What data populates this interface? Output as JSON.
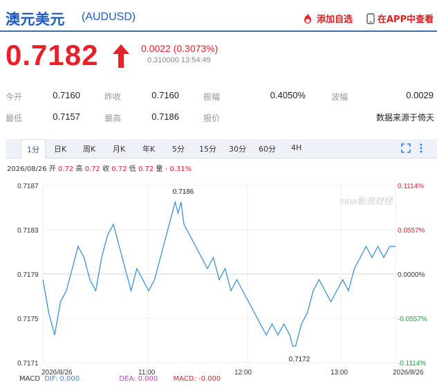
{
  "header": {
    "title_cn": "澳元美元",
    "title_code": "(AUDUSD)",
    "add_watch_label": "添加自选",
    "app_view_label": "在APP中查看",
    "icons": {
      "add_watch": "flame-icon",
      "app_view": "phone-icon"
    }
  },
  "quote": {
    "price": "0.7182",
    "change": "0.0022 (0.3073%)",
    "sub_info": "0.310000 13:54:49",
    "direction": "up",
    "up_color": "#e8202a"
  },
  "stats": [
    [
      {
        "label": "今开",
        "value": "0.7160"
      },
      {
        "label": "昨收",
        "value": "0.7160"
      },
      {
        "label": "振幅",
        "value": "0.4050%"
      },
      {
        "label": "波幅",
        "value": "0.0029"
      }
    ],
    [
      {
        "label": "最低",
        "value": "0.7157"
      },
      {
        "label": "最高",
        "value": "0.7186"
      },
      {
        "label": "报价",
        "value": ""
      },
      {
        "label": "",
        "value": "数据来源于倚天"
      }
    ]
  ],
  "tabs": [
    "1分",
    "日K",
    "周K",
    "月K",
    "年K",
    "5分",
    "15分",
    "30分",
    "60分",
    "4H"
  ],
  "active_tab": "1分",
  "toolbar_icons": [
    "fullscreen-icon",
    "more-icon"
  ],
  "ohlc": {
    "date": "2026/08/26",
    "open_label": "开",
    "open": "0.72",
    "high_label": "高",
    "high": "0.72",
    "close_label": "收",
    "close": "0.72",
    "low_label": "低",
    "low": "0.72",
    "vol_label": "量",
    "vol_value": "- 0.31%"
  },
  "chart_data": {
    "type": "line",
    "yticks_left": [
      "0.7187",
      "0.7183",
      "0.7179",
      "0.7175",
      "0.7171"
    ],
    "yticks_right": [
      "0.1114%",
      "0.0557%",
      "0.0000%",
      "-0.0557%",
      "-0.1114%"
    ],
    "xticks": [
      "2026/8/26",
      "11:00",
      "12:00",
      "13:00",
      "2026/8/26"
    ],
    "ylim": [
      0.7171,
      0.7187
    ],
    "annotations": [
      {
        "text": "0.7186",
        "x": 94,
        "y": 0.7186
      },
      {
        "text": "0.7172",
        "x": 173,
        "y": 0.7172
      }
    ],
    "watermark": "sina新浪财经",
    "series": [
      {
        "color": "#3b8fd4",
        "x": [
          0,
          4,
          8,
          12,
          16,
          20,
          24,
          28,
          32,
          36,
          40,
          44,
          48,
          52,
          56,
          60,
          64,
          68,
          72,
          76,
          80,
          84,
          88,
          90,
          92,
          94,
          96,
          100,
          104,
          108,
          112,
          116,
          120,
          124,
          128,
          132,
          136,
          140,
          144,
          148,
          152,
          156,
          160,
          164,
          168,
          170,
          172,
          174,
          176,
          180,
          184,
          188,
          192,
          196,
          200,
          204,
          208,
          212,
          216,
          220,
          224,
          228,
          232,
          236,
          240
        ],
        "values": [
          0.71785,
          0.71755,
          0.71735,
          0.71765,
          0.71775,
          0.71795,
          0.71815,
          0.71805,
          0.71785,
          0.71775,
          0.71805,
          0.71825,
          0.71835,
          0.71815,
          0.71795,
          0.71775,
          0.71795,
          0.71785,
          0.71775,
          0.71785,
          0.71805,
          0.71825,
          0.71845,
          0.71855,
          0.71845,
          0.71855,
          0.71835,
          0.71825,
          0.71815,
          0.71805,
          0.71795,
          0.71805,
          0.71785,
          0.71795,
          0.71775,
          0.71785,
          0.71775,
          0.71765,
          0.71755,
          0.71745,
          0.71735,
          0.71745,
          0.71735,
          0.71745,
          0.71735,
          0.71725,
          0.71725,
          0.71735,
          0.71745,
          0.71755,
          0.71775,
          0.71785,
          0.71775,
          0.71765,
          0.71775,
          0.71785,
          0.71775,
          0.71795,
          0.71805,
          0.71815,
          0.71805,
          0.71815,
          0.71805,
          0.71815,
          0.71815
        ]
      }
    ]
  },
  "macd": {
    "label": "MACD",
    "dif": "DIF: 0.000",
    "dea": "DEA: 0.000",
    "macd": "MACD: -0.000"
  }
}
